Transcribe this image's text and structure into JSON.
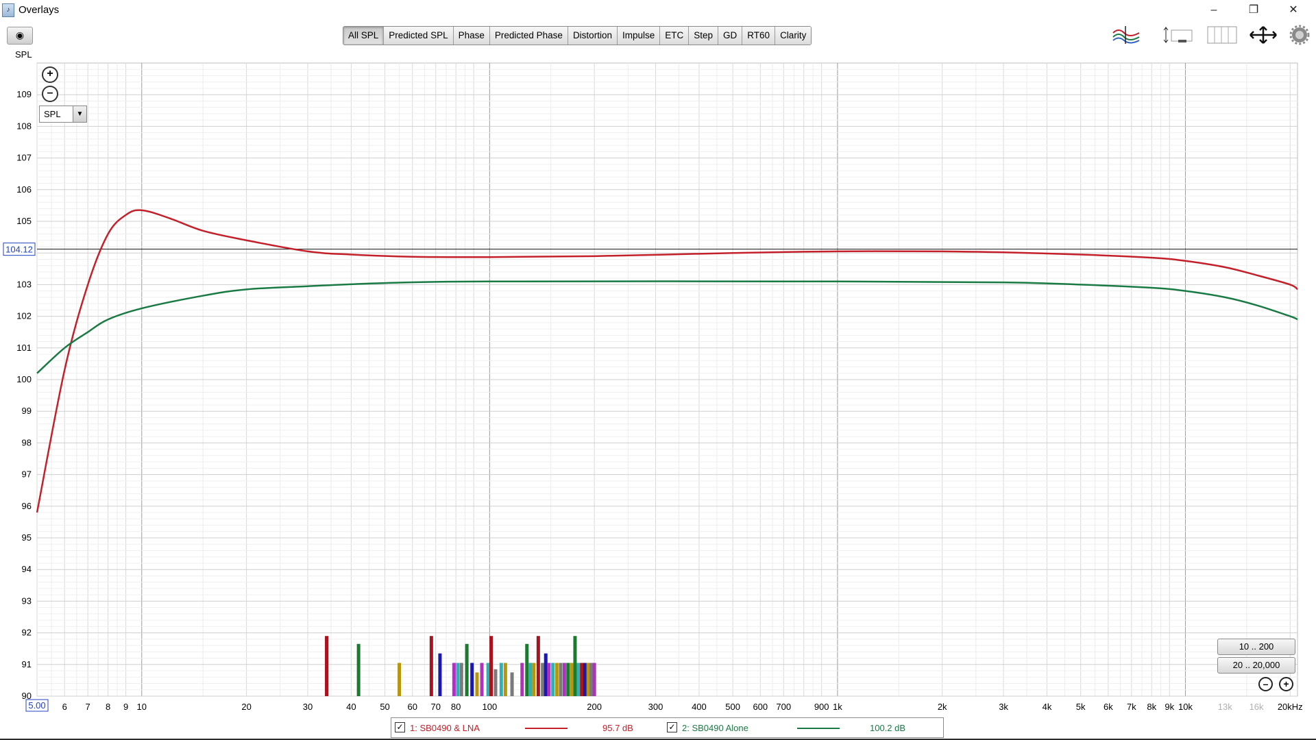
{
  "window": {
    "title": "Overlays",
    "app_icon": "rew-app-icon"
  },
  "toolbar": {
    "camera_icon": "camera-icon",
    "view_label": "SPL",
    "tabs": [
      {
        "label": "All SPL",
        "active": true
      },
      {
        "label": "Predicted SPL"
      },
      {
        "label": "Phase"
      },
      {
        "label": "Predicted Phase"
      },
      {
        "label": "Distortion"
      },
      {
        "label": "Impulse"
      },
      {
        "label": "ETC"
      },
      {
        "label": "Step"
      },
      {
        "label": "GD"
      },
      {
        "label": "RT60"
      },
      {
        "label": "Clarity"
      }
    ],
    "right_icons": [
      "curve-controls-icon",
      "limits-icon",
      "column-icon",
      "pan-icon",
      "settings-gear-icon"
    ]
  },
  "left_controls": {
    "dropdown_value": "SPL",
    "zoom_in_icon": "zoom-in-icon",
    "zoom_out_icon": "zoom-out-icon"
  },
  "cursor": {
    "y_value": "104.12",
    "x_start": "5.00"
  },
  "range_buttons": [
    "10 .. 200",
    "20 .. 20,000"
  ],
  "colors": {
    "red": "#c4202a",
    "green": "#1a7a44",
    "grid": "#d9d9d9"
  },
  "chart_data": {
    "type": "line",
    "ylabel": "SPL",
    "x_scale": "log",
    "xlim": [
      5,
      21000
    ],
    "ylim": [
      90,
      110
    ],
    "y_ticks": [
      90,
      91,
      92,
      93,
      94,
      95,
      96,
      97,
      98,
      99,
      100,
      101,
      102,
      103,
      104,
      105,
      106,
      107,
      108,
      109
    ],
    "x_ticks": [
      {
        "v": 6,
        "t": "6"
      },
      {
        "v": 7,
        "t": "7"
      },
      {
        "v": 8,
        "t": "8"
      },
      {
        "v": 9,
        "t": "9"
      },
      {
        "v": 10,
        "t": "10"
      },
      {
        "v": 20,
        "t": "20"
      },
      {
        "v": 30,
        "t": "30"
      },
      {
        "v": 40,
        "t": "40"
      },
      {
        "v": 50,
        "t": "50"
      },
      {
        "v": 60,
        "t": "60"
      },
      {
        "v": 70,
        "t": "70"
      },
      {
        "v": 80,
        "t": "80"
      },
      {
        "v": 100,
        "t": "100"
      },
      {
        "v": 200,
        "t": "200"
      },
      {
        "v": 300,
        "t": "300"
      },
      {
        "v": 400,
        "t": "400"
      },
      {
        "v": 500,
        "t": "500"
      },
      {
        "v": 600,
        "t": "600"
      },
      {
        "v": 700,
        "t": "700"
      },
      {
        "v": 900,
        "t": "900"
      },
      {
        "v": 1000,
        "t": "1k"
      },
      {
        "v": 2000,
        "t": "2k"
      },
      {
        "v": 3000,
        "t": "3k"
      },
      {
        "v": 4000,
        "t": "4k"
      },
      {
        "v": 5000,
        "t": "5k"
      },
      {
        "v": 6000,
        "t": "6k"
      },
      {
        "v": 7000,
        "t": "7k"
      },
      {
        "v": 8000,
        "t": "8k"
      },
      {
        "v": 9000,
        "t": "9k"
      },
      {
        "v": 10000,
        "t": "10k"
      },
      {
        "v": 13000,
        "t": "13k",
        "faint": true
      },
      {
        "v": 16000,
        "t": "16k",
        "faint": true
      },
      {
        "v": 20000,
        "t": "20kHz"
      }
    ],
    "cursor_y": 104.12,
    "series": [
      {
        "name": "1: SB0490 & LNA",
        "level": "95.7 dB",
        "color": "#c4202a",
        "points": [
          [
            5,
            95.8
          ],
          [
            6,
            100.3
          ],
          [
            7,
            103.0
          ],
          [
            8,
            104.6
          ],
          [
            9,
            105.2
          ],
          [
            10,
            105.35
          ],
          [
            12,
            105.1
          ],
          [
            15,
            104.7
          ],
          [
            20,
            104.4
          ],
          [
            30,
            104.05
          ],
          [
            40,
            103.95
          ],
          [
            60,
            103.88
          ],
          [
            100,
            103.87
          ],
          [
            200,
            103.9
          ],
          [
            500,
            104.0
          ],
          [
            1000,
            104.05
          ],
          [
            2000,
            104.05
          ],
          [
            3000,
            104.02
          ],
          [
            5000,
            103.95
          ],
          [
            8000,
            103.85
          ],
          [
            10000,
            103.75
          ],
          [
            13000,
            103.55
          ],
          [
            16000,
            103.3
          ],
          [
            20000,
            103.0
          ],
          [
            21000,
            102.85
          ]
        ]
      },
      {
        "name": "2: SB0490 Alone",
        "level": "100.2 dB",
        "color": "#1a7a44",
        "points": [
          [
            5,
            100.2
          ],
          [
            6,
            101.0
          ],
          [
            7,
            101.5
          ],
          [
            8,
            101.9
          ],
          [
            10,
            102.25
          ],
          [
            15,
            102.65
          ],
          [
            20,
            102.85
          ],
          [
            30,
            102.95
          ],
          [
            50,
            103.05
          ],
          [
            100,
            103.1
          ],
          [
            1000,
            103.1
          ],
          [
            3000,
            103.07
          ],
          [
            5000,
            103.0
          ],
          [
            8000,
            102.9
          ],
          [
            10000,
            102.8
          ],
          [
            13000,
            102.6
          ],
          [
            16000,
            102.35
          ],
          [
            20000,
            102.0
          ],
          [
            21000,
            101.9
          ]
        ]
      }
    ],
    "peaks": [
      {
        "f": 34,
        "h": 91.9,
        "c": "#a8141e"
      },
      {
        "f": 42,
        "h": 91.65,
        "c": "#1a7a2e"
      },
      {
        "f": 55,
        "h": 91.05,
        "c": "#b8960c"
      },
      {
        "f": 68,
        "h": 91.9,
        "c": "#a8141e"
      },
      {
        "f": 72,
        "h": 91.35,
        "c": "#1a1aa8"
      },
      {
        "f": 79,
        "h": 91.05,
        "c": "#b030c0"
      },
      {
        "f": 81,
        "h": 91.05,
        "c": "#30b0b0"
      },
      {
        "f": 83,
        "h": 91.05,
        "c": "#7a7a7a"
      },
      {
        "f": 86,
        "h": 91.65,
        "c": "#1a7a2e"
      },
      {
        "f": 89,
        "h": 91.05,
        "c": "#1a1aa8"
      },
      {
        "f": 92,
        "h": 90.75,
        "c": "#b8960c"
      },
      {
        "f": 95,
        "h": 91.05,
        "c": "#b030c0"
      },
      {
        "f": 99,
        "h": 91.05,
        "c": "#30b0b0"
      },
      {
        "f": 101,
        "h": 91.9,
        "c": "#a8141e"
      },
      {
        "f": 104,
        "h": 90.85,
        "c": "#7a7a7a"
      },
      {
        "f": 108,
        "h": 91.05,
        "c": "#30b0b0"
      },
      {
        "f": 111,
        "h": 91.05,
        "c": "#b8960c"
      },
      {
        "f": 116,
        "h": 90.75,
        "c": "#7a7a7a"
      },
      {
        "f": 124,
        "h": 91.05,
        "c": "#b030c0"
      },
      {
        "f": 128,
        "h": 91.65,
        "c": "#1a7a2e"
      },
      {
        "f": 131,
        "h": 91.05,
        "c": "#30b0b0"
      },
      {
        "f": 134,
        "h": 91.05,
        "c": "#b8960c"
      },
      {
        "f": 138,
        "h": 91.9,
        "c": "#a8141e"
      },
      {
        "f": 142,
        "h": 91.05,
        "c": "#7a7a7a"
      },
      {
        "f": 145,
        "h": 91.35,
        "c": "#1a1aa8"
      },
      {
        "f": 148,
        "h": 91.05,
        "c": "#b030c0"
      },
      {
        "f": 152,
        "h": 91.05,
        "c": "#30b0b0"
      },
      {
        "f": 156,
        "h": 91.05,
        "c": "#b8960c"
      },
      {
        "f": 160,
        "h": 91.05,
        "c": "#7a7a7a"
      },
      {
        "f": 164,
        "h": 91.05,
        "c": "#b030c0"
      },
      {
        "f": 168,
        "h": 91.05,
        "c": "#1a7a2e"
      },
      {
        "f": 172,
        "h": 91.05,
        "c": "#b8960c"
      },
      {
        "f": 176,
        "h": 91.9,
        "c": "#1a7a2e"
      },
      {
        "f": 180,
        "h": 91.05,
        "c": "#30b0b0"
      },
      {
        "f": 184,
        "h": 91.05,
        "c": "#a8141e"
      },
      {
        "f": 188,
        "h": 91.05,
        "c": "#1a1aa8"
      },
      {
        "f": 192,
        "h": 91.05,
        "c": "#b8960c"
      },
      {
        "f": 196,
        "h": 91.05,
        "c": "#7a7a7a"
      },
      {
        "f": 200,
        "h": 91.05,
        "c": "#b030c0"
      }
    ]
  }
}
